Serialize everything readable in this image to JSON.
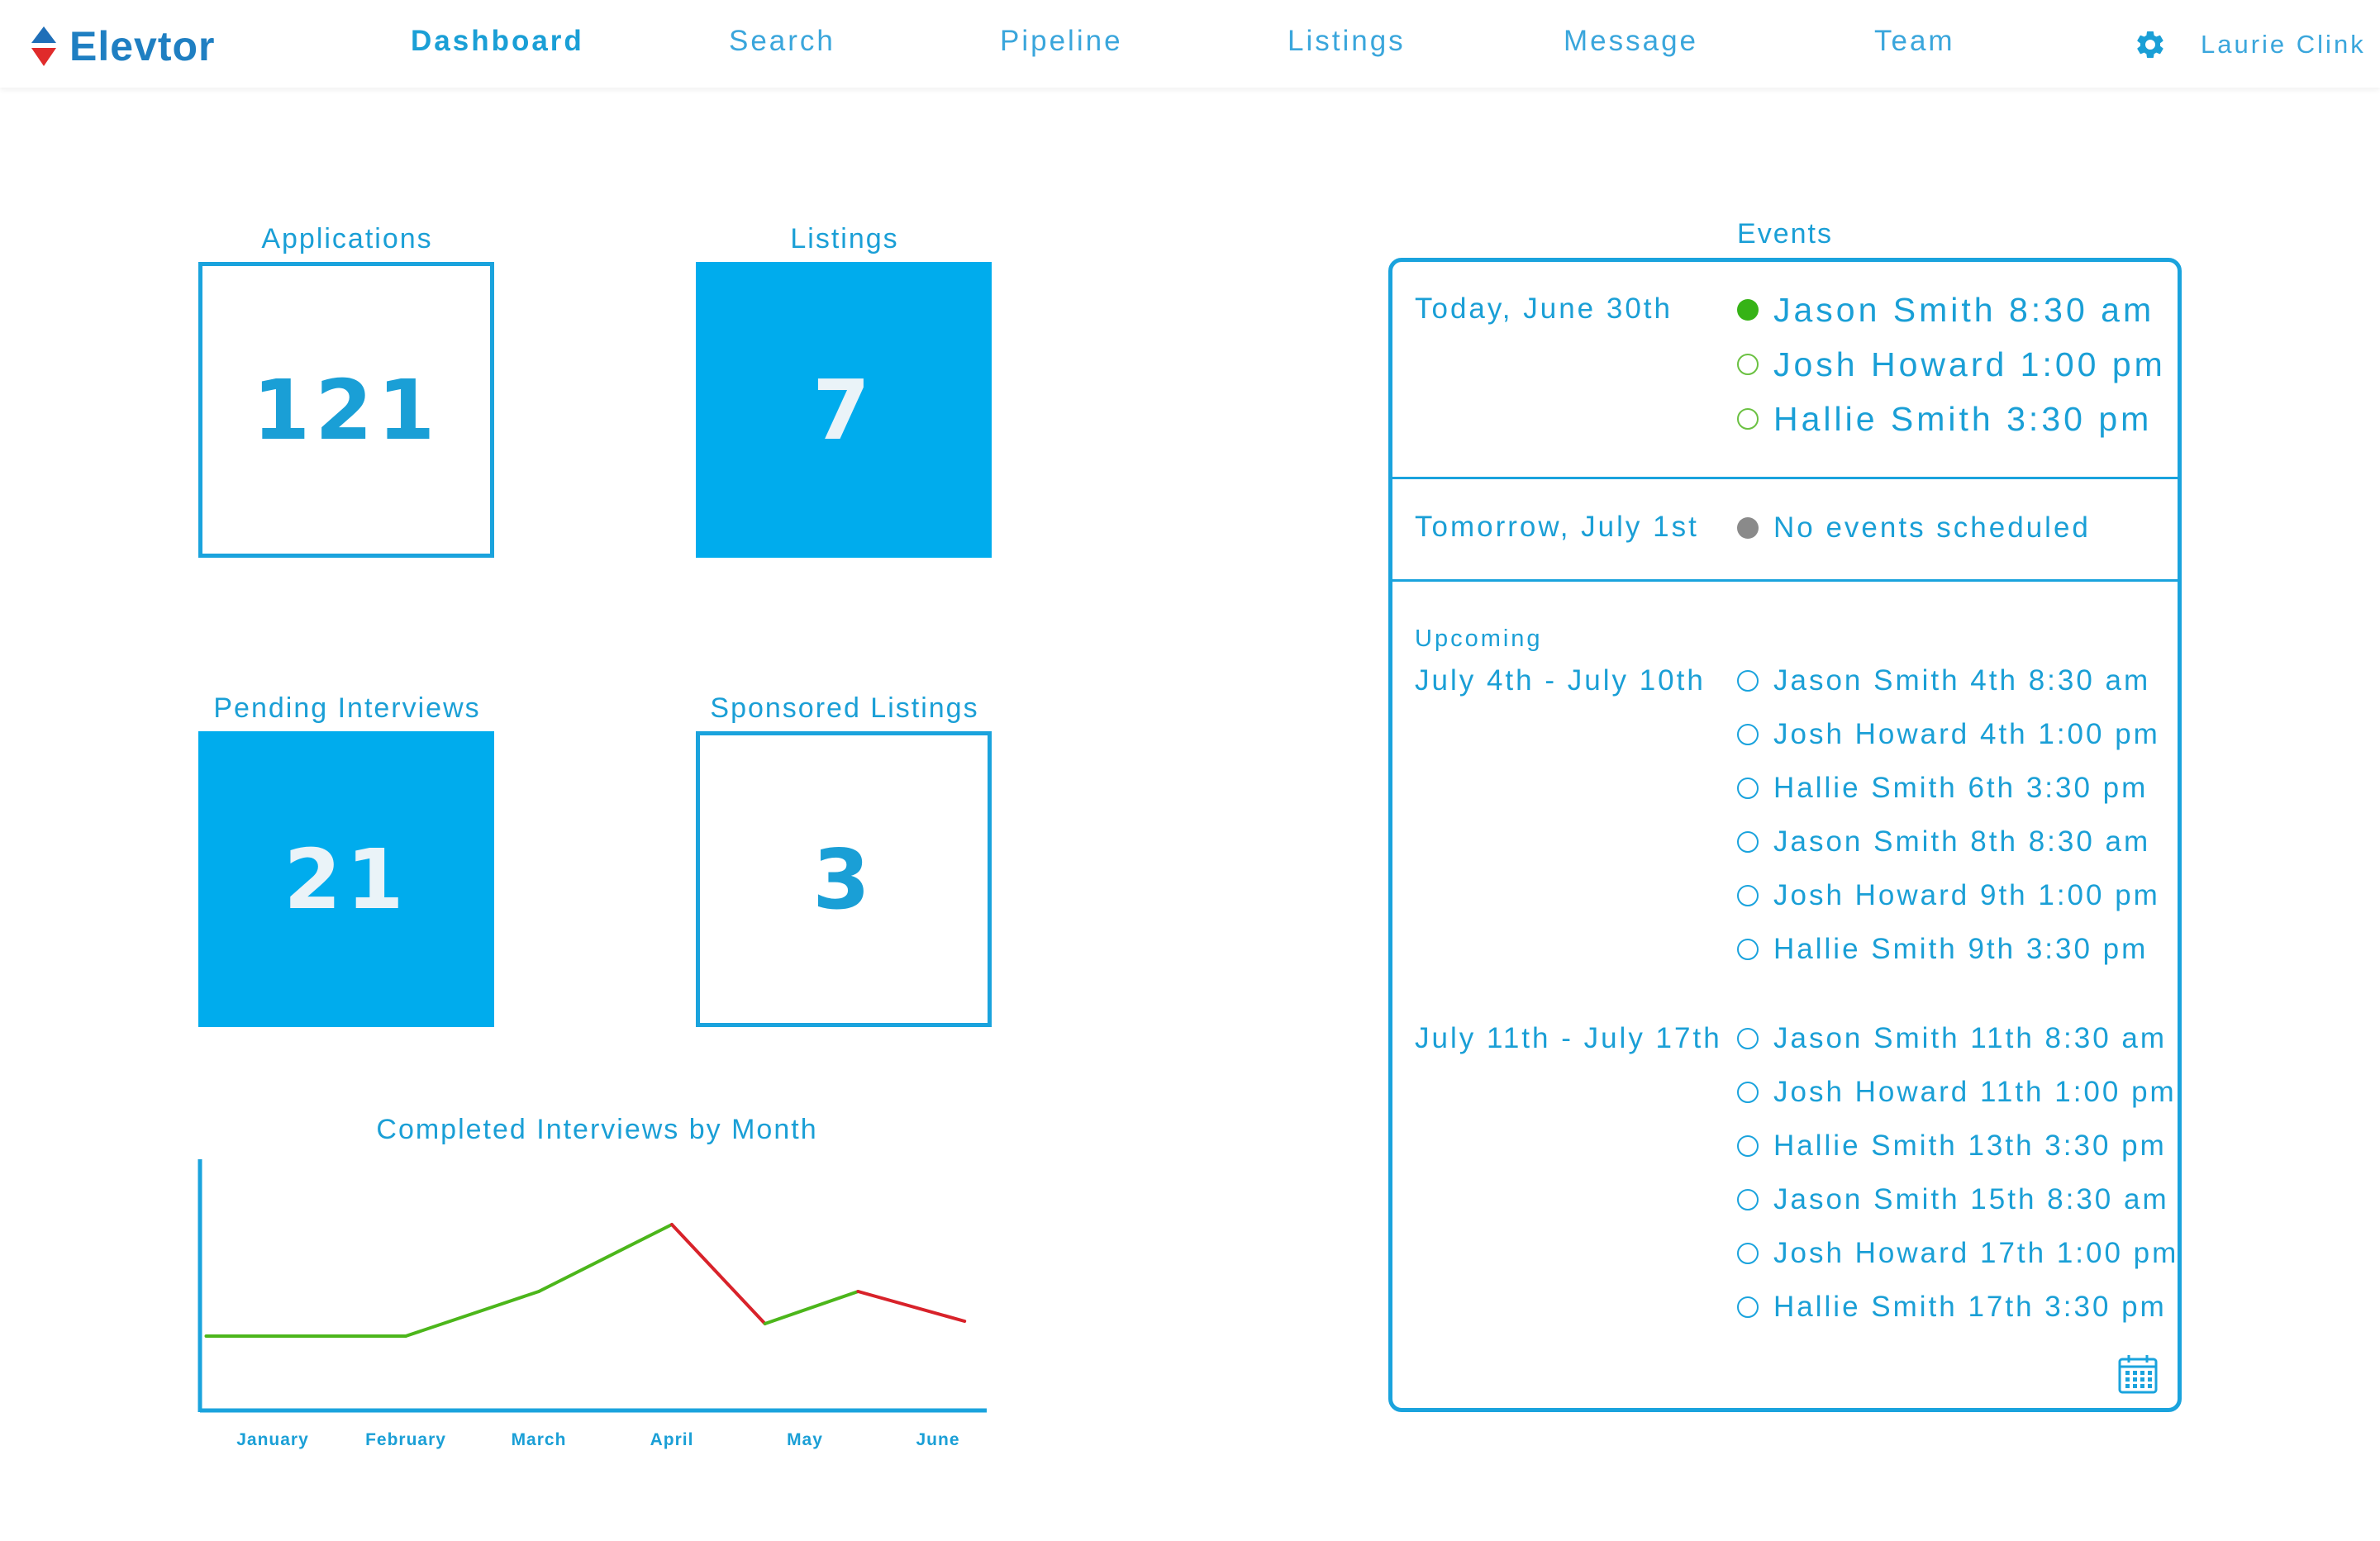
{
  "brand": {
    "name": "Elevtor"
  },
  "nav": {
    "items": [
      "Dashboard",
      "Search",
      "Pipeline",
      "Listings",
      "Message",
      "Team"
    ],
    "active": "Dashboard",
    "user_name": "Laurie Clink"
  },
  "stats": {
    "applications": {
      "label": "Applications",
      "value": "121"
    },
    "listings": {
      "label": "Listings",
      "value": "7"
    },
    "pending_interviews": {
      "label": "Pending Interviews",
      "value": "21"
    },
    "sponsored_listings": {
      "label": "Sponsored Listings",
      "value": "3"
    }
  },
  "chart_data": {
    "type": "line",
    "title": "Completed Interviews by Month",
    "categories": [
      "January",
      "February",
      "March",
      "April",
      "May",
      "June"
    ],
    "x": [
      0,
      1,
      2,
      3,
      4,
      5
    ],
    "points": [
      {
        "x": -0.5,
        "y": 3.0
      },
      {
        "x": 1.0,
        "y": 3.0
      },
      {
        "x": 2.0,
        "y": 4.8
      },
      {
        "x": 3.0,
        "y": 7.5
      },
      {
        "x": 3.7,
        "y": 3.5
      },
      {
        "x": 4.4,
        "y": 4.8
      },
      {
        "x": 5.2,
        "y": 3.6
      }
    ],
    "colors": {
      "up": "#4cb61b",
      "down": "#d8222a",
      "axis": "#1aa3dd"
    },
    "xlabel": "",
    "ylabel": "",
    "ylim": [
      0,
      10
    ],
    "grid": false
  },
  "events": {
    "title": "Events",
    "today": {
      "label": "Today, June 30th",
      "items": [
        {
          "text": "Jason Smith 8:30 am",
          "status": "done"
        },
        {
          "text": "Josh Howard 1:00 pm",
          "status": "pending"
        },
        {
          "text": "Hallie Smith 3:30 pm",
          "status": "pending"
        }
      ]
    },
    "tomorrow": {
      "label": "Tomorrow, July 1st",
      "items": [
        {
          "text": "No events scheduled",
          "status": "none"
        }
      ]
    },
    "upcoming": {
      "label": "Upcoming",
      "weeks": [
        {
          "label": "July 4th - July 10th",
          "items": [
            "Jason Smith 4th 8:30 am",
            "Josh Howard 4th 1:00 pm",
            "Hallie Smith 6th 3:30 pm",
            "Jason Smith 8th 8:30 am",
            "Josh Howard 9th 1:00 pm",
            "Hallie Smith 9th 3:30 pm"
          ]
        },
        {
          "label": "July 11th - July 17th",
          "items": [
            "Jason Smith 11th 8:30 am",
            "Josh Howard 11th 1:00 pm",
            "Hallie Smith 13th 3:30 pm",
            "Jason Smith 15th 8:30 am",
            "Josh Howard 17th 1:00 pm",
            "Hallie Smith 17th 3:30 pm"
          ]
        }
      ]
    },
    "calendar_icon": "calendar-icon"
  }
}
